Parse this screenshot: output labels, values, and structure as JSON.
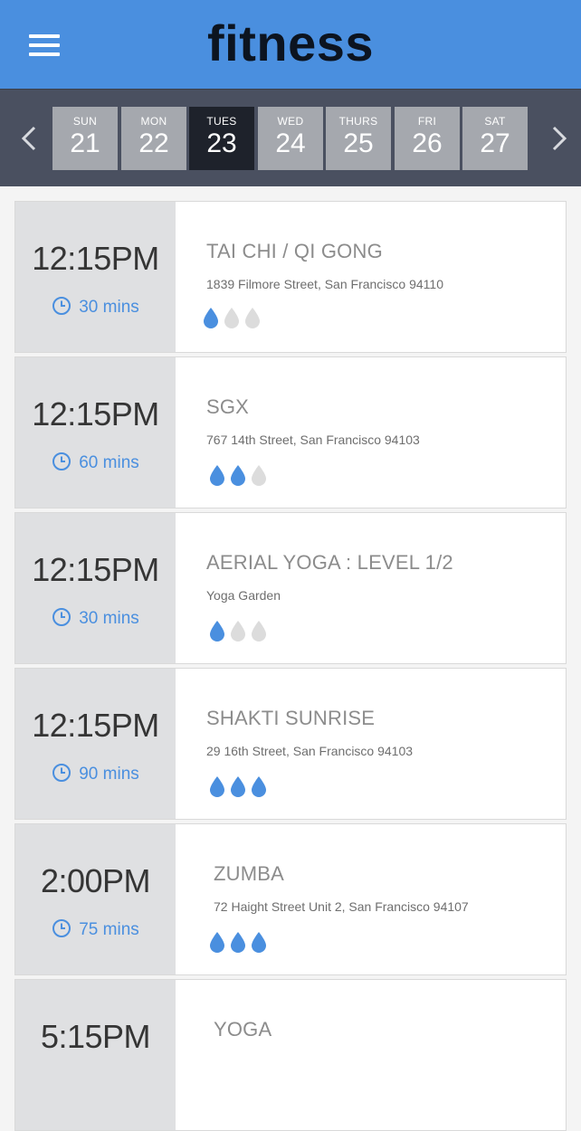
{
  "header": {
    "brand": "fitness"
  },
  "datebar": {
    "days": [
      {
        "name": "SUN",
        "num": "21",
        "active": false
      },
      {
        "name": "MON",
        "num": "22",
        "active": false
      },
      {
        "name": "TUES",
        "num": "23",
        "active": true
      },
      {
        "name": "WED",
        "num": "24",
        "active": false
      },
      {
        "name": "THURS",
        "num": "25",
        "active": false
      },
      {
        "name": "FRI",
        "num": "26",
        "active": false
      },
      {
        "name": "SAT",
        "num": "27",
        "active": false
      }
    ]
  },
  "colors": {
    "accent": "#4a8fdf",
    "drop_on": "#4a8fdf",
    "drop_off": "#dcdcdc"
  },
  "classes": [
    {
      "time": "12:15PM",
      "duration": "30 mins",
      "title": "TAI CHI / QI GONG",
      "address": "1839 Filmore Street, San Francisco 94110",
      "intensity": 1
    },
    {
      "time": "12:15PM",
      "duration": "60 mins",
      "title": "SGX",
      "address": "767 14th Street, San Francisco 94103",
      "intensity": 2
    },
    {
      "time": "12:15PM",
      "duration": "30 mins",
      "title": "AERIAL YOGA : LEVEL 1/2",
      "address": "Yoga Garden",
      "intensity": 1
    },
    {
      "time": "12:15PM",
      "duration": "90 mins",
      "title": "SHAKTI SUNRISE",
      "address": "29 16th Street, San Francisco 94103",
      "intensity": 3
    },
    {
      "time": "2:00PM",
      "duration": "75 mins",
      "title": "ZUMBA",
      "address": "72 Haight Street Unit 2, San Francisco 94107",
      "intensity": 3
    },
    {
      "time": "5:15PM",
      "duration": "",
      "title": "YOGA",
      "address": "",
      "intensity": 0
    }
  ]
}
